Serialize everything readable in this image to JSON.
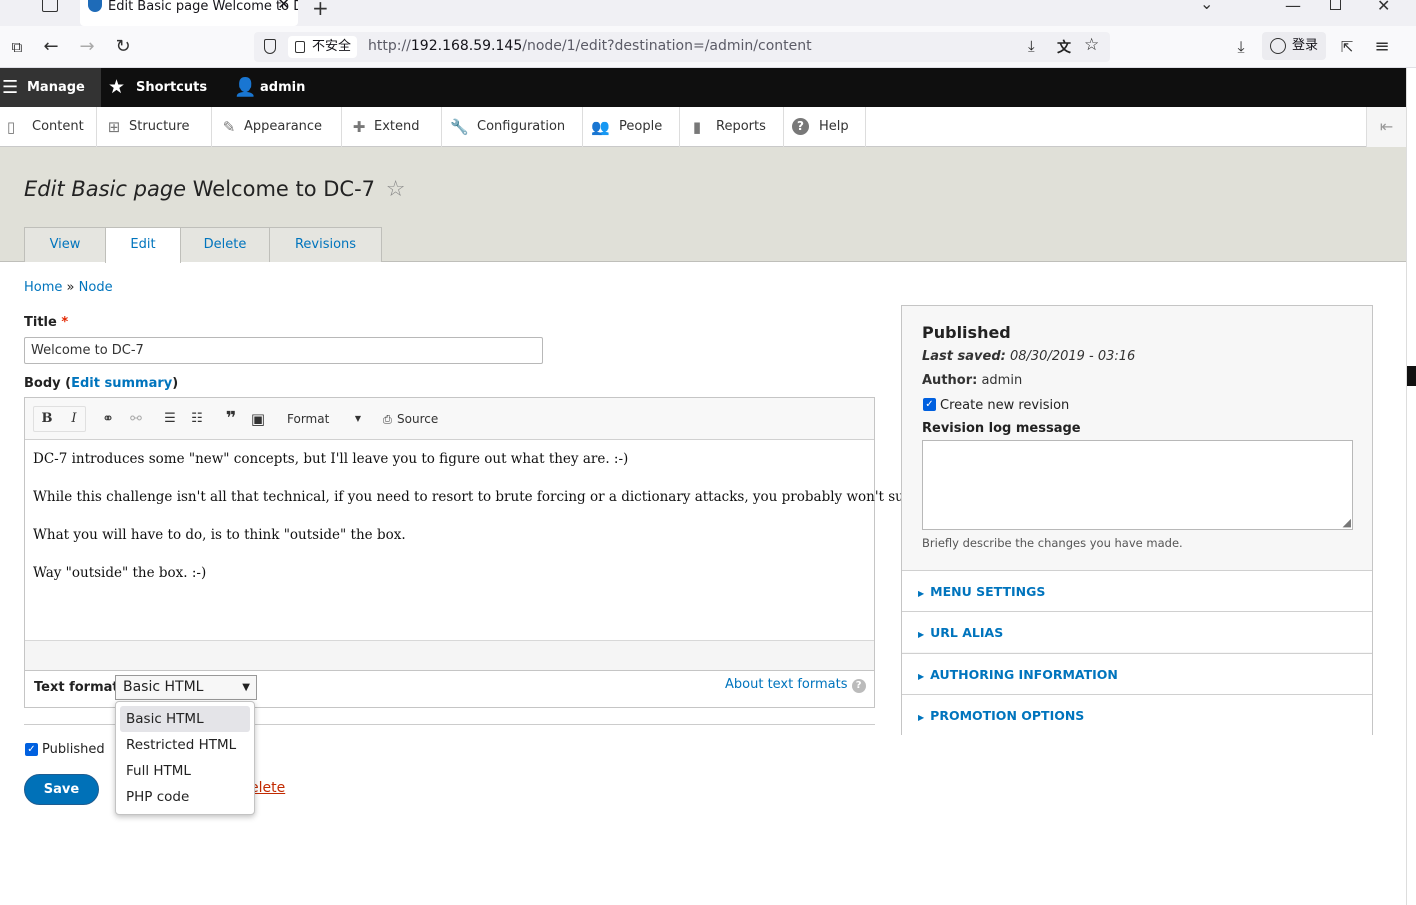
{
  "browser": {
    "tab_title": "Edit Basic page Welcome to D",
    "insecure_label": "不安全",
    "url_base": "http://",
    "url_host": "192.168.59.145",
    "url_path": "/node/1/edit?destination=/admin/content",
    "login_label": "登录"
  },
  "toolbar": {
    "manage": "Manage",
    "shortcuts": "Shortcuts",
    "user": "admin"
  },
  "tray": [
    {
      "label": "Content",
      "icon": "content-icon"
    },
    {
      "label": "Structure",
      "icon": "structure-icon"
    },
    {
      "label": "Appearance",
      "icon": "appearance-icon"
    },
    {
      "label": "Extend",
      "icon": "extend-icon"
    },
    {
      "label": "Configuration",
      "icon": "configuration-icon"
    },
    {
      "label": "People",
      "icon": "people-icon"
    },
    {
      "label": "Reports",
      "icon": "reports-icon"
    },
    {
      "label": "Help",
      "icon": "help-icon"
    }
  ],
  "page": {
    "title_type": "Edit Basic page",
    "title_name": "Welcome to DC-7",
    "tabs": [
      "View",
      "Edit",
      "Delete",
      "Revisions"
    ]
  },
  "breadcrumb": {
    "home": "Home",
    "sep": "»",
    "node": "Node"
  },
  "form": {
    "title_label": "Title",
    "required_mark": "*",
    "title_value": "Welcome to DC-7",
    "body_label": "Body",
    "edit_summary": "Edit summary",
    "paren_open": "(",
    "paren_close": ")",
    "toolbar": {
      "format": "Format",
      "source": "Source"
    },
    "body_paragraphs": [
      "DC-7 introduces some \"new\" concepts, but I'll leave you to figure out what they are.  :-)",
      "While this challenge isn't all that technical, if you need to resort to brute forcing or a dictionary attacks, you probably won't succeed.",
      "What you will have to do, is to think \"outside\" the box.",
      "Way \"outside\" the box.  :-)"
    ],
    "text_format_label": "Text format",
    "text_format_value": "Basic HTML",
    "about_formats": "About text formats",
    "format_options": [
      "Basic HTML",
      "Restricted HTML",
      "Full HTML",
      "PHP code"
    ],
    "published_label": "Published",
    "save_label": "Save",
    "delete_label": "Delete",
    "delete_visible": "elete"
  },
  "sidebar": {
    "status": "Published",
    "last_saved_label": "Last saved:",
    "last_saved_value": "08/30/2019 - 03:16",
    "author_label": "Author:",
    "author_value": "admin",
    "new_revision": "Create new revision",
    "revlog_label": "Revision log message",
    "revlog_help": "Briefly describe the changes you have made.",
    "sections": [
      "Menu settings",
      "URL alias",
      "Authoring information",
      "Promotion options"
    ]
  }
}
